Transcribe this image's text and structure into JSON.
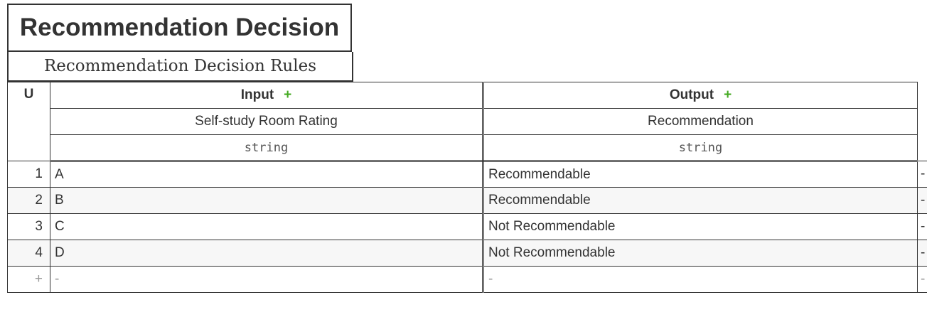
{
  "table_name": "Recommendation Decision",
  "table_subtitle": "Recommendation Decision Rules",
  "hit_policy": "U",
  "input": {
    "section_label": "Input",
    "add_symbol": "+",
    "column_name": "Self-study Room Rating",
    "column_type": "string"
  },
  "output": {
    "section_label": "Output",
    "add_symbol": "+",
    "column_name": "Recommendation",
    "column_type": "string"
  },
  "rules": [
    {
      "index": "1",
      "input": "A",
      "output": "Recommendable",
      "annotation": "-"
    },
    {
      "index": "2",
      "input": "B",
      "output": "Recommendable",
      "annotation": "-"
    },
    {
      "index": "3",
      "input": "C",
      "output": "Not Recommendable",
      "annotation": "-"
    },
    {
      "index": "4",
      "input": "D",
      "output": "Not Recommendable",
      "annotation": "-"
    }
  ],
  "add_row": {
    "plus": "+",
    "input_placeholder": "-",
    "output_placeholder": "-",
    "annotation_placeholder": "-"
  },
  "colors": {
    "accent_green": "#44aa22",
    "border": "#333333",
    "alt_row": "#f7f7f7"
  }
}
